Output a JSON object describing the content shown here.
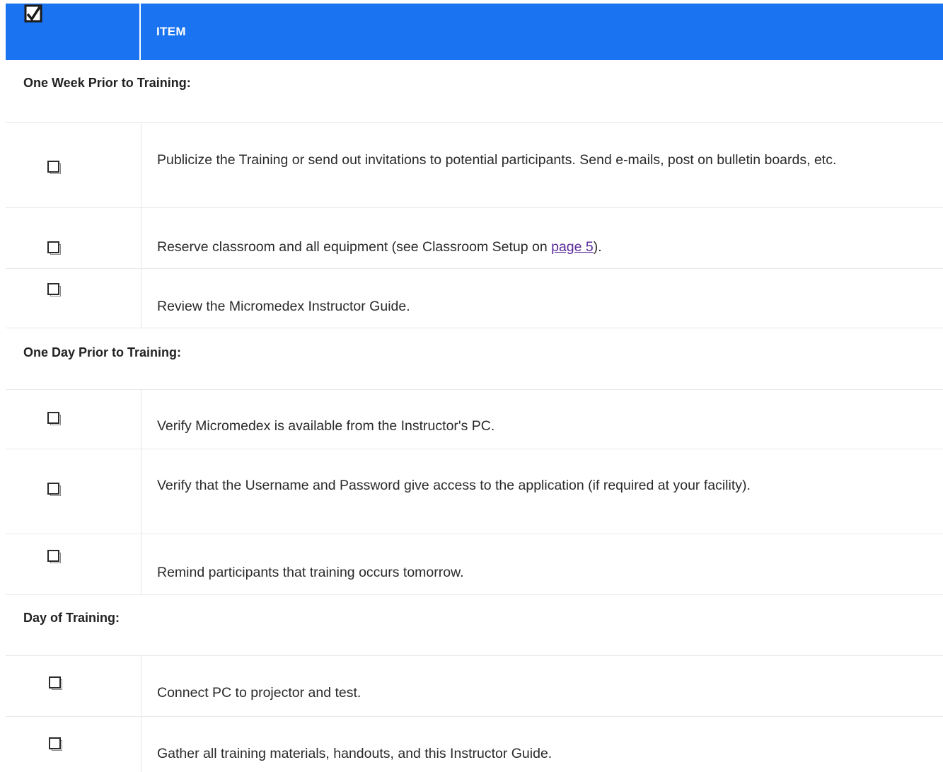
{
  "header": {
    "title": "ITEM",
    "icon": "checked-checkbox-icon",
    "color": "#1a73f0"
  },
  "sections": [
    {
      "title": "One Week Prior to Training:"
    },
    {
      "title": "One Day Prior to Training:"
    },
    {
      "title": "Day of Training:"
    }
  ],
  "items": [
    {
      "text": "Publicize the Training or send out invitations to potential participants. Send e-mails, post on bulletin boards, etc."
    },
    {
      "pre": "Reserve classroom and all equipment (see Classroom Setup on ",
      "link": "page 5",
      "post": ")."
    },
    {
      "text": "Review the Micromedex Instructor Guide."
    },
    {
      "text": "Verify Micromedex is available from the Instructor's PC."
    },
    {
      "text": "Verify that the Username and Password give access to the application (if required at your facility)."
    },
    {
      "text": "Remind participants that training occurs tomorrow."
    },
    {
      "text": "Connect PC to projector and test."
    },
    {
      "text": "Gather all training materials, handouts, and this Instructor Guide."
    }
  ],
  "icons": {
    "unchecked": "empty-checkbox-icon"
  }
}
